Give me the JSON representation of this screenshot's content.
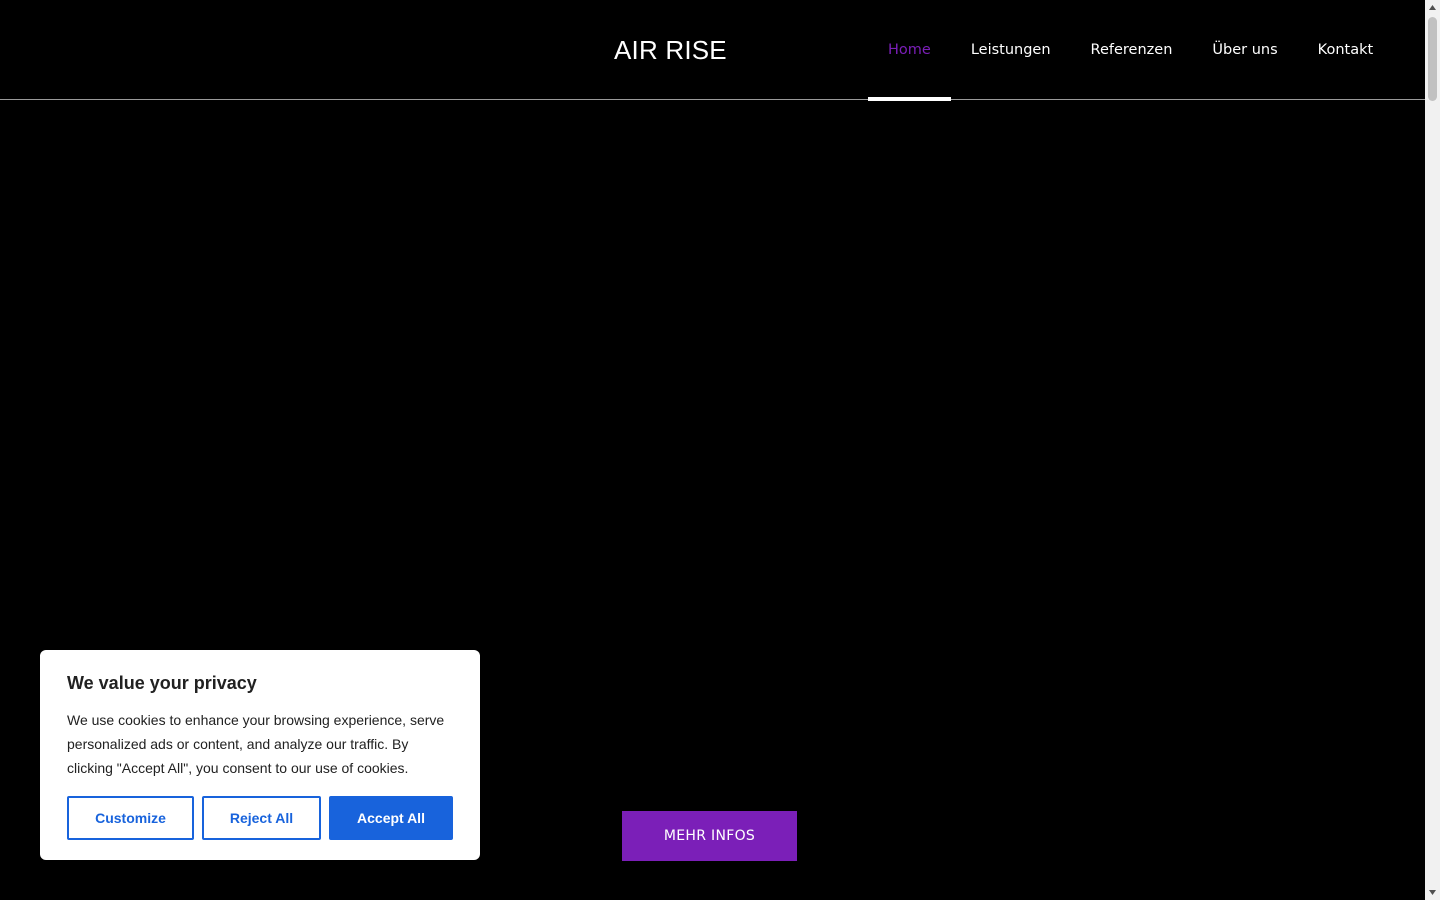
{
  "header": {
    "logo": "AIR RISE",
    "nav": [
      {
        "label": "Home",
        "active": true
      },
      {
        "label": "Leistungen",
        "active": false
      },
      {
        "label": "Referenzen",
        "active": false
      },
      {
        "label": "Über uns",
        "active": false
      },
      {
        "label": "Kontakt",
        "active": false
      }
    ]
  },
  "hero": {
    "cta_label": "MEHR INFOS"
  },
  "cookie_banner": {
    "title": "We value your privacy",
    "text": "We use cookies to enhance your browsing experience, serve personalized ads or content, and analyze our traffic. By clicking \"Accept All\", you consent to our use of cookies.",
    "customize_label": "Customize",
    "reject_label": "Reject All",
    "accept_label": "Accept All"
  },
  "colors": {
    "background": "#000000",
    "accent": "#7b1fb8",
    "cookie_button": "#1863dc"
  },
  "icons": {
    "scroll_up": "triangle-up-icon",
    "scroll_down": "triangle-down-icon"
  }
}
